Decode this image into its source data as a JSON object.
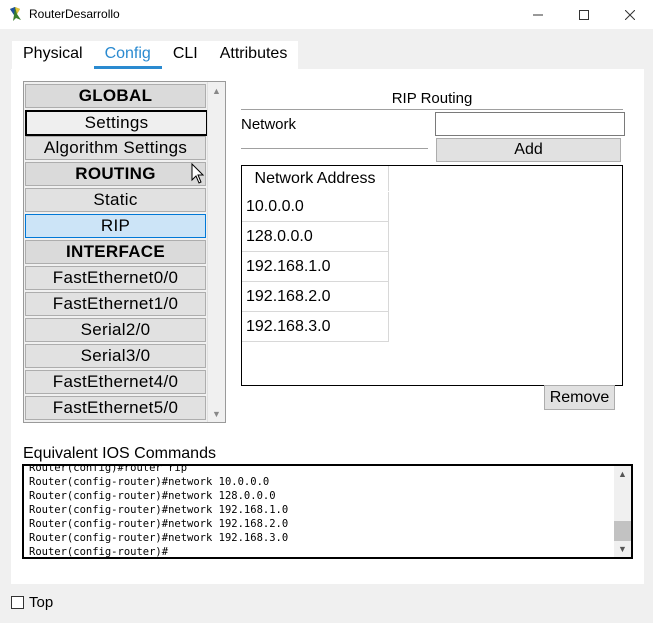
{
  "window": {
    "title": "RouterDesarrollo",
    "minimize_icon": "minimize-icon",
    "maximize_icon": "maximize-icon",
    "close_icon": "close-icon"
  },
  "tabs": [
    {
      "label": "Physical",
      "active": false
    },
    {
      "label": "Config",
      "active": true
    },
    {
      "label": "CLI",
      "active": false
    },
    {
      "label": "Attributes",
      "active": false
    }
  ],
  "left_list": {
    "items": [
      {
        "label": "GLOBAL",
        "kind": "header"
      },
      {
        "label": "Settings",
        "kind": "item",
        "state": "focused"
      },
      {
        "label": "Algorithm Settings",
        "kind": "item"
      },
      {
        "label": "ROUTING",
        "kind": "header"
      },
      {
        "label": "Static",
        "kind": "item"
      },
      {
        "label": "RIP",
        "kind": "item",
        "state": "selected"
      },
      {
        "label": "INTERFACE",
        "kind": "header"
      },
      {
        "label": "FastEthernet0/0",
        "kind": "item"
      },
      {
        "label": "FastEthernet1/0",
        "kind": "item"
      },
      {
        "label": "Serial2/0",
        "kind": "item"
      },
      {
        "label": "Serial3/0",
        "kind": "item"
      },
      {
        "label": "FastEthernet4/0",
        "kind": "item"
      },
      {
        "label": "FastEthernet5/0",
        "kind": "item"
      }
    ]
  },
  "rip": {
    "title": "RIP Routing",
    "network_label": "Network",
    "network_value": "",
    "add_label": "Add",
    "remove_label": "Remove",
    "table_header": "Network Address",
    "networks": [
      "10.0.0.0",
      "128.0.0.0",
      "192.168.1.0",
      "192.168.2.0",
      "192.168.3.0"
    ]
  },
  "ios": {
    "label": "Equivalent IOS Commands",
    "lines": [
      "Router(config)#router rip",
      "Router(config-router)#network 10.0.0.0",
      "Router(config-router)#network 128.0.0.0",
      "Router(config-router)#network 192.168.1.0",
      "Router(config-router)#network 192.168.2.0",
      "Router(config-router)#network 192.168.3.0",
      "Router(config-router)#"
    ]
  },
  "footer": {
    "top_label": "Top",
    "top_checked": false
  },
  "colors": {
    "accent": "#2a8ad0",
    "selected_bg": "#cce4f7",
    "selected_border": "#0078d7"
  }
}
